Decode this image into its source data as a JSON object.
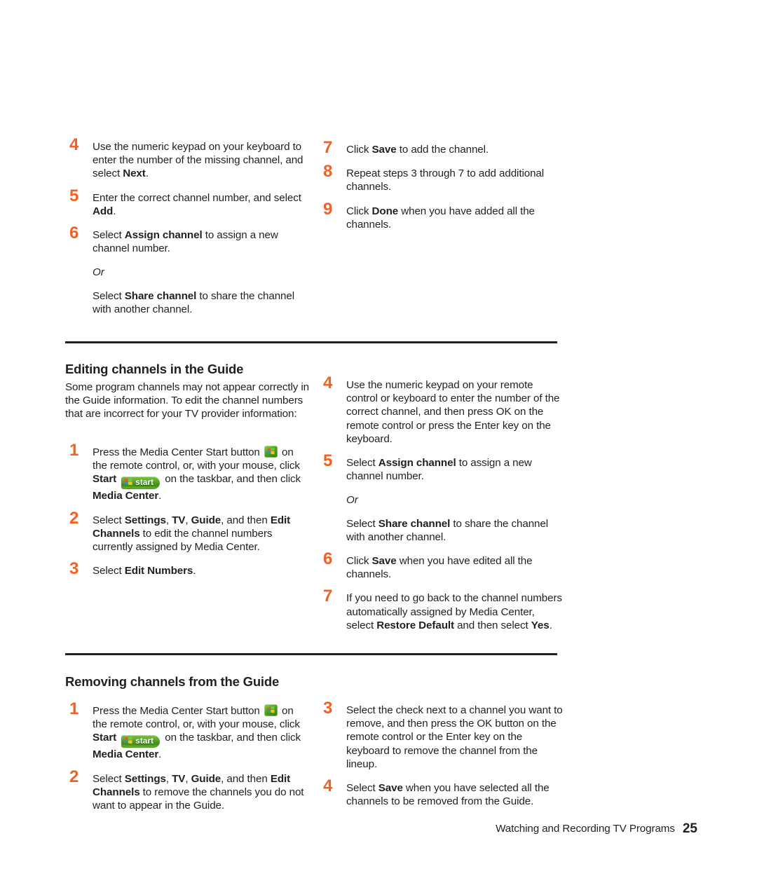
{
  "page": {
    "number": "25",
    "footer_text": "Watching and Recording TV Programs",
    "accent_color": "#f26122",
    "text_color": "#231f20",
    "rule_color": "#231f20"
  },
  "icons": {
    "media_center_start_button": "media-center-start-icon",
    "taskbar_start_button": "windows-start-button-icon",
    "taskbar_start_label": "start"
  },
  "top_section": {
    "left_steps": [
      {
        "num": "4",
        "html": "Use the numeric keypad on your keyboard to enter the number of the missing channel, and select <b>Next</b>."
      },
      {
        "num": "5",
        "html": "Enter the correct channel number, and select <b>Add</b>."
      },
      {
        "num": "6",
        "html": "Select <b>Assign channel</b> to assign a new channel number."
      }
    ],
    "or_label": "Or",
    "share_html": "Select <b>Share channel</b> to share the channel with another channel."
  },
  "top_section_right": {
    "steps": [
      {
        "num": "7",
        "html": "Click <b>Save</b> to add the channel."
      },
      {
        "num": "8",
        "html": "Repeat steps 3 through 7 to add additional channels."
      },
      {
        "num": "9",
        "html": "Click <b>Done</b> when you have added all the channels."
      }
    ]
  },
  "editing_section": {
    "title": "Editing channels in the Guide",
    "intro": "Some program channels may not appear correctly in the Guide information. To edit the channel numbers that are incorrect for your TV provider information:",
    "left_steps": [
      {
        "num": "1",
        "html": "Press the Media Center Start button <MC> on the remote control, or, with your mouse, click <b>Start</b> <START> on the taskbar, and then click <b>Media Center</b>."
      },
      {
        "num": "2",
        "html": "Select <b>Settings</b>, <b>TV</b>, <b>Guide</b>, and then <b>Edit Channels</b> to edit the channel numbers currently assigned by Media Center."
      },
      {
        "num": "3",
        "html": "Select <b>Edit Numbers</b>."
      }
    ],
    "right_steps": [
      {
        "num": "4",
        "html": "Use the numeric keypad on your remote control or keyboard to enter the number of the correct channel, and then press OK on the remote control or press the Enter key on the keyboard."
      },
      {
        "num": "5",
        "html": "Select <b>Assign channel</b> to assign a new channel number."
      }
    ],
    "or_label": "Or",
    "share_html": "Select <b>Share channel</b> to share the channel with another channel.",
    "right_steps_after": [
      {
        "num": "6",
        "html": "Click <b>Save</b> when you have edited all the channels."
      },
      {
        "num": "7",
        "html": "If you need to go back to the channel numbers automatically assigned by Media Center, select <b>Restore Default</b> and then select <b>Yes</b>."
      }
    ]
  },
  "removing_section": {
    "title": "Removing channels from the Guide",
    "left_steps": [
      {
        "num": "1",
        "html": "Press the Media Center Start button <MC> on the remote control, or, with your mouse, click <b>Start</b> <START> on the taskbar, and then click <b>Media Center</b>."
      },
      {
        "num": "2",
        "html": "Select <b>Settings</b>, <b>TV</b>, <b>Guide</b>, and then <b>Edit Channels</b> to remove the channels you do not want to appear in the Guide."
      }
    ],
    "right_steps": [
      {
        "num": "3",
        "html": "Select the check next to a channel you want to remove, and then press the OK button on the remote control or the Enter key on the keyboard to remove the channel from the lineup."
      },
      {
        "num": "4",
        "html": "Select <b>Save</b> when you have selected all the channels to be removed from the Guide."
      }
    ]
  }
}
